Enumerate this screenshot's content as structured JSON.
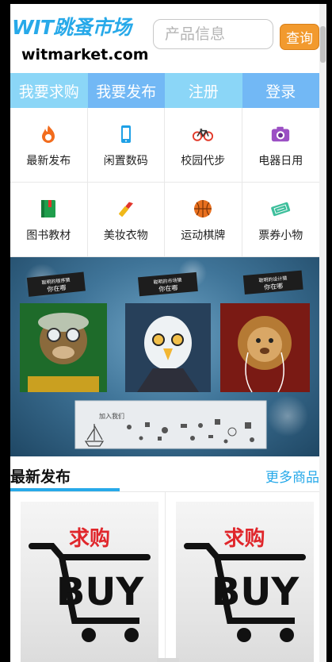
{
  "header": {
    "logo_title": "WIT跳蚤市场",
    "logo_url": "witmarket.com",
    "search_placeholder": "产品信息",
    "search_button": "查询"
  },
  "nav": [
    "我要求购",
    "我要发布",
    "注册",
    "登录"
  ],
  "categories": [
    {
      "label": "最新发布",
      "icon": "flame-icon",
      "color": "#f26c1d"
    },
    {
      "label": "闲置数码",
      "icon": "phone-icon",
      "color": "#1ea0e6"
    },
    {
      "label": "校园代步",
      "icon": "bicycle-icon",
      "color": "#e23a2a"
    },
    {
      "label": "电器日用",
      "icon": "camera-icon",
      "color": "#9b4fc4"
    },
    {
      "label": "图书教材",
      "icon": "book-icon",
      "color": "#1f9e4c"
    },
    {
      "label": "美妆衣物",
      "icon": "lipstick-icon",
      "color": "#f0b81a"
    },
    {
      "label": "运动棋牌",
      "icon": "basketball-icon",
      "color": "#e8701f"
    },
    {
      "label": "票券小物",
      "icon": "ticket-icon",
      "color": "#3ebf9c"
    }
  ],
  "banner": {
    "signs": [
      "聪明的程序猿",
      "你在哪",
      "聪明的市场猿",
      "你在哪",
      "聪明的设计猿",
      "你在哪"
    ],
    "join_text": "加入我们"
  },
  "latest": {
    "title": "最新发布",
    "more": "更多商品",
    "products": [
      {
        "title": "求购",
        "image_text": "BUY"
      },
      {
        "title": "求购",
        "image_text": "BUY"
      }
    ]
  },
  "colors": {
    "brand": "#27a9e9",
    "nav_light": "#8bd6f7",
    "nav_dark": "#72b8f5",
    "search_button": "#f29a2e",
    "product_title": "#e0262b"
  }
}
